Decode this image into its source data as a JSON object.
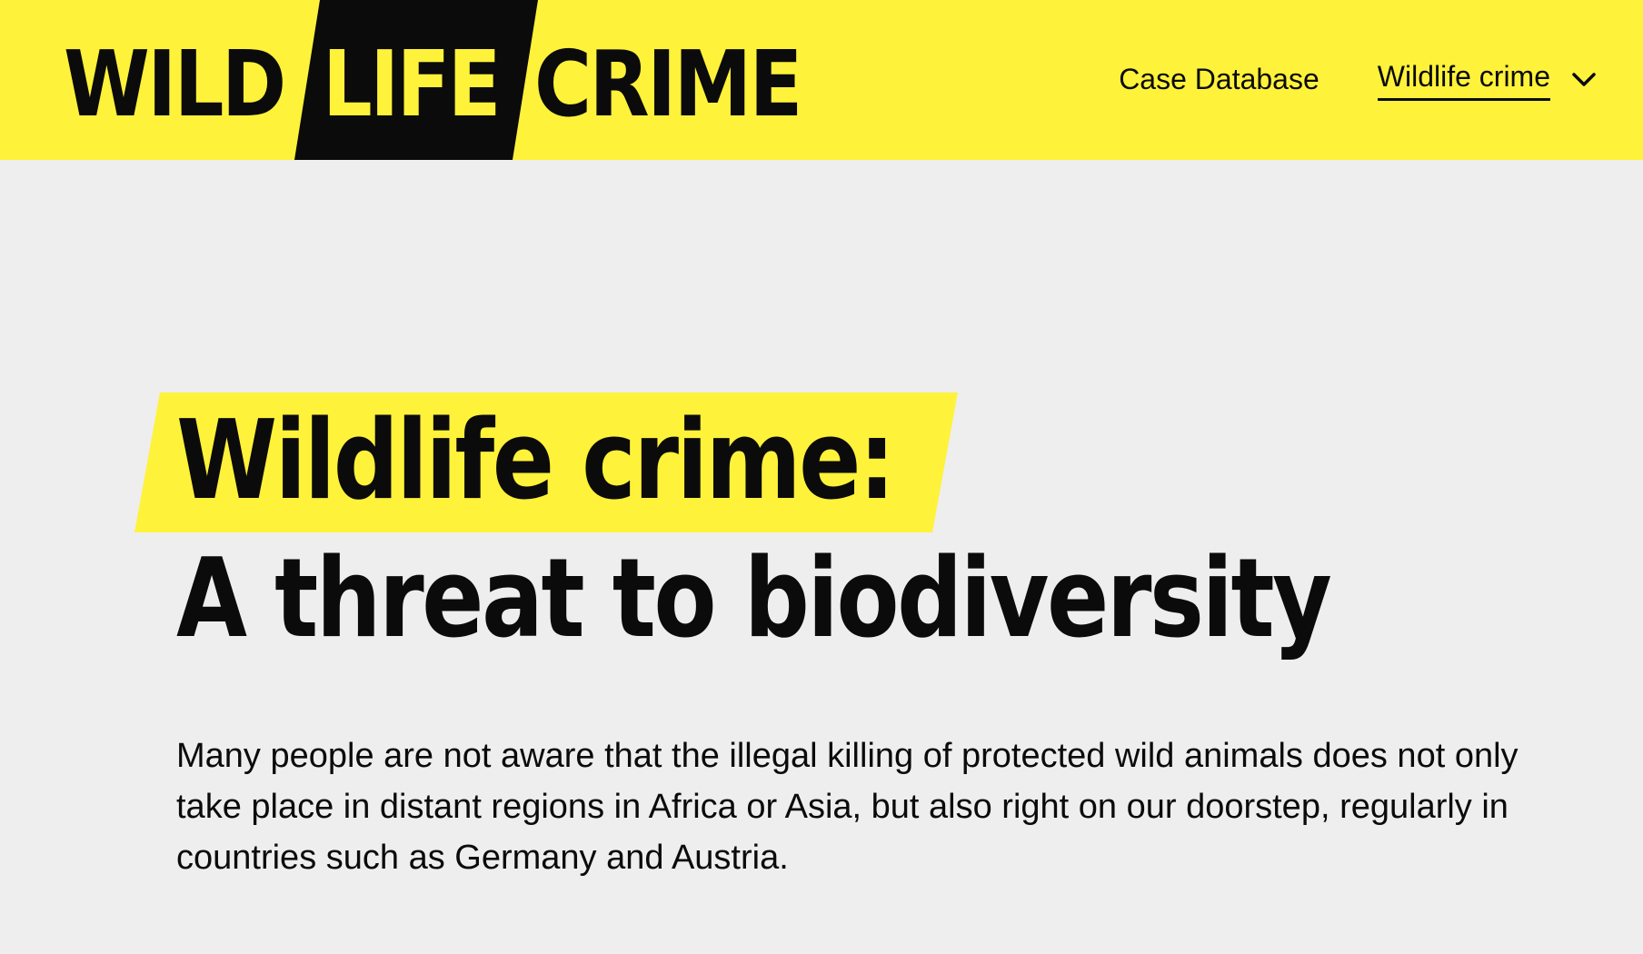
{
  "brand": {
    "logo": {
      "part1": "WILD",
      "part2": "LIFE",
      "part3": "CRIME"
    }
  },
  "nav": {
    "items": [
      {
        "label": "Case Database"
      },
      {
        "label": "Wildlife crime",
        "active": true,
        "has_dropdown": true
      }
    ],
    "dropdown_icon": "chevron-down-icon"
  },
  "hero": {
    "title_line1": "Wildlife crime:",
    "title_line2": "A threat to biodiversity",
    "intro": "Many people are not aware that the illegal killing of protected wild animals does not only take place in distant regions in Africa or Asia, but also right on our doorstep, regularly in countries such as Germany and Austria."
  },
  "colors": {
    "accent_yellow": "#fff23a",
    "page_background": "#eeeeee",
    "text": "#0b0b0b"
  }
}
